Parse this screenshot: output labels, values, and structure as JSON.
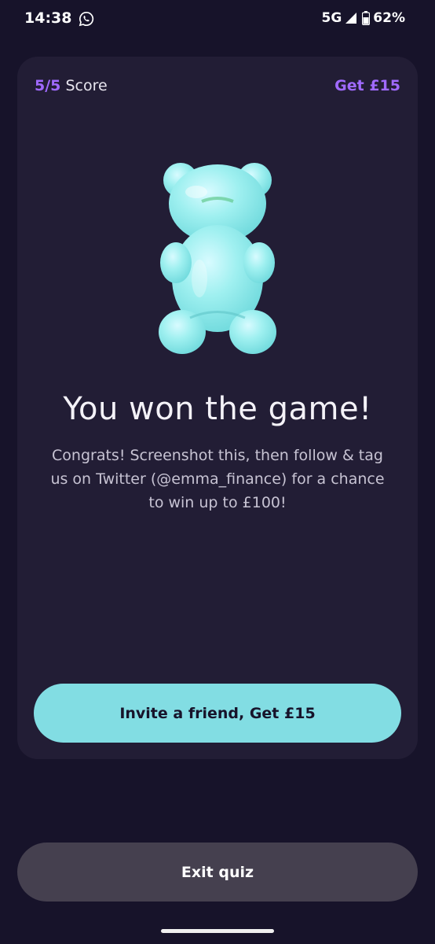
{
  "status_bar": {
    "time": "14:38",
    "network": "5G",
    "battery": "62%",
    "icons": [
      "whatsapp-icon",
      "signal-icon",
      "battery-icon"
    ]
  },
  "quiz_card": {
    "score_value": "5/5",
    "score_label": "Score",
    "reward_label": "Get £15",
    "headline": "You won the game!",
    "body": "Congrats! Screenshot this, then follow & tag us on Twitter (@emma_finance) for a chance to win up to  £100!",
    "invite_button_label": "Invite a friend, Get £15"
  },
  "exit_button_label": "Exit quiz",
  "colors": {
    "background": "#17132a",
    "card": "#221d35",
    "accent_purple": "#a06aff",
    "accent_teal": "#82dde3",
    "exit_button": "#45404f"
  }
}
